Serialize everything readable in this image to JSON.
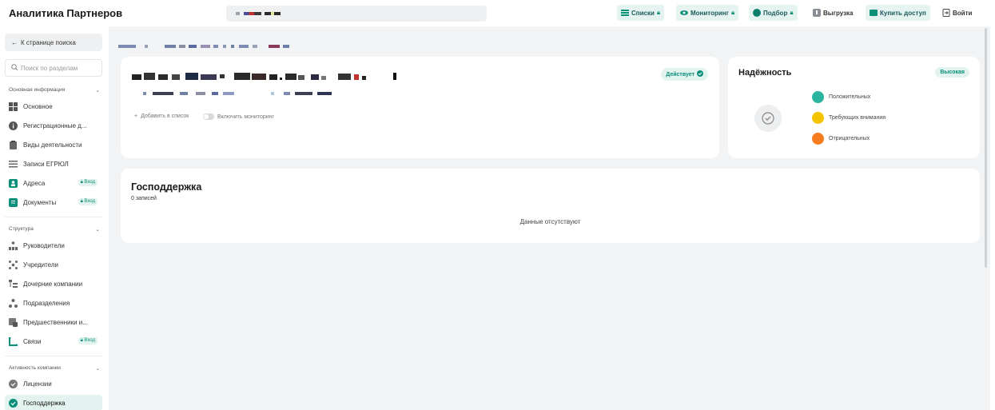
{
  "app": {
    "title": "Аналитика Партнеров"
  },
  "topnav": [
    {
      "label": "Списки",
      "locked": true,
      "icon": "list-icon"
    },
    {
      "label": "Мониторинг",
      "locked": true,
      "icon": "eye-icon"
    },
    {
      "label": "Подбор",
      "locked": true,
      "icon": "circle-icon"
    },
    {
      "label": "Выгрузка",
      "locked": false,
      "icon": "download-icon"
    },
    {
      "label": "Купить доступ",
      "locked": false,
      "icon": "card-icon"
    },
    {
      "label": "Войти",
      "locked": false,
      "icon": "login-icon"
    }
  ],
  "sidebar": {
    "back_label": "К странице поиска",
    "search_placeholder": "Поиск по разделам",
    "sections": [
      {
        "title": "Основная информация",
        "items": [
          {
            "label": "Основное",
            "icon": "grid-icon"
          },
          {
            "label": "Регистрационные д...",
            "icon": "info-icon"
          },
          {
            "label": "Виды деятельности",
            "icon": "clipboard-icon"
          },
          {
            "label": "Записи ЕГРЮЛ",
            "icon": "list-icon"
          },
          {
            "label": "Адреса",
            "icon": "address-icon",
            "badge": "Вход"
          },
          {
            "label": "Документы",
            "icon": "document-icon",
            "badge": "Вход"
          }
        ]
      },
      {
        "title": "Структура",
        "items": [
          {
            "label": "Руководители",
            "icon": "org-chart-icon"
          },
          {
            "label": "Учредители",
            "icon": "network-icon"
          },
          {
            "label": "Дочерние компании",
            "icon": "tree-icon"
          },
          {
            "label": "Подразделения",
            "icon": "branches-icon"
          },
          {
            "label": "Предшественники и...",
            "icon": "history-icon"
          },
          {
            "label": "Связи",
            "icon": "links-icon",
            "badge": "Вход"
          }
        ]
      },
      {
        "title": "Активность компании",
        "items": [
          {
            "label": "Лицензии",
            "icon": "license-icon"
          },
          {
            "label": "Господдержка",
            "icon": "support-icon",
            "active": true
          }
        ]
      }
    ]
  },
  "company": {
    "status": "Действует",
    "add_to_list": "Добавить в список",
    "monitoring_toggle": "Включить мониторинг"
  },
  "reliability": {
    "title": "Надёжность",
    "level": "Высокая",
    "legend": [
      {
        "label": "Положительных",
        "color": "#2bb5a0"
      },
      {
        "label": "Требующих внимания",
        "color": "#f5c400"
      },
      {
        "label": "Отрицательных",
        "color": "#f57c1f"
      }
    ]
  },
  "support": {
    "title": "Господдержка",
    "count": "0 записей",
    "empty": "Данные отсутствуют"
  }
}
